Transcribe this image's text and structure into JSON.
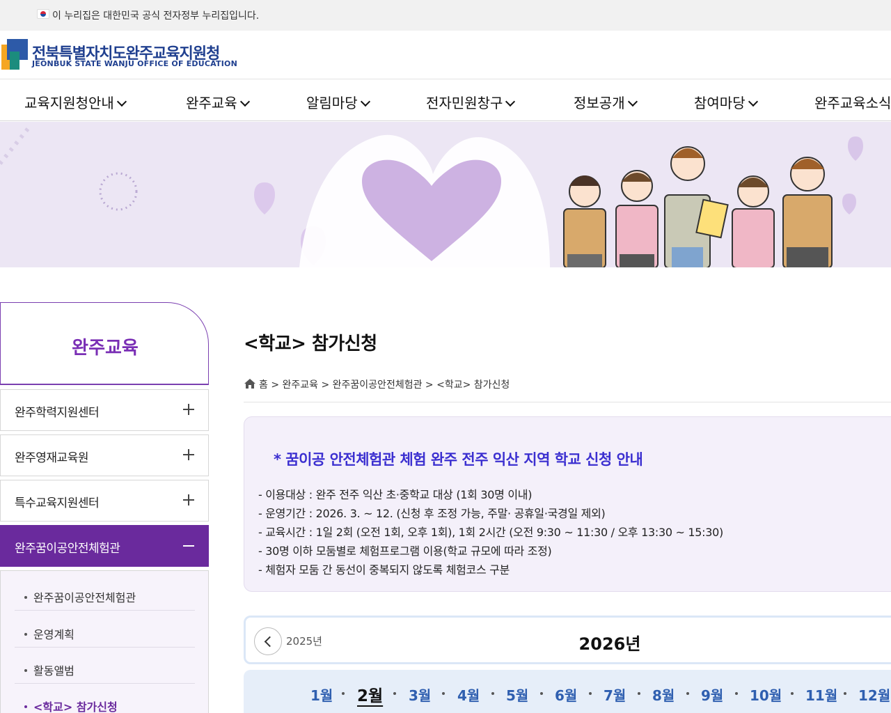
{
  "gov_banner": {
    "text": "이 누리집은 대한민국 공식 전자정부 누리집입니다."
  },
  "header": {
    "title": "전북특별자치도완주교육지원청",
    "subtitle": "JEONBUK STATE WANJU OFFICE OF EDUCATION"
  },
  "nav": [
    "교육지원청안내",
    "완주교육",
    "알림마당",
    "전자민원창구",
    "정보공개",
    "참여마당",
    "완주교육소식"
  ],
  "sidebar": {
    "title": "완주교육",
    "menus": [
      {
        "label": "완주학력지원센터"
      },
      {
        "label": "완주영재교육원"
      },
      {
        "label": "특수교육지원센터"
      },
      {
        "label": "완주꿈이공안전체험관"
      }
    ],
    "submenu": [
      {
        "label": "완주꿈이공안전체험관"
      },
      {
        "label": "운영계획"
      },
      {
        "label": "활동앨범"
      },
      {
        "label": "<학교> 참가신청"
      }
    ]
  },
  "page": {
    "title": "<학교> 참가신청",
    "breadcrumb": "홈 > 완주교육 > 완주꿈이공안전체험관 > <학교> 참가신청"
  },
  "info": {
    "title": "* 꿈이공 안전체험관 체험 완주 전주 익산 지역 학교 신청 안내",
    "lines": [
      "- 이용대상 : 완주 전주 익산 초·중학교 대상 (1회 30명 이내)",
      "- 운영기간 : 2026. 3. ~ 12. (신청 후 조정 가능, 주말· 공휴일·국경일 제외)",
      "- 교육시간 : 1일 2회 (오전 1회, 오후 1회), 1회 2시간 (오전 9:30 ~ 11:30 / 오후 13:30 ~ 15:30)",
      "- 30명 이하 모둠별로 체험프로그램 이용(학교 규모에 따라 조정)",
      "- 체험자 모둠 간 동선이 중복되지 않도록 체험코스 구분"
    ]
  },
  "calendar": {
    "prev_year": "2025년",
    "current_year": "2026년",
    "months": [
      "1월",
      "2월",
      "3월",
      "4월",
      "5월",
      "6월",
      "7월",
      "8월",
      "9월",
      "10월",
      "11월",
      "12월"
    ],
    "selected_month": "2월"
  },
  "colors": {
    "brand_purple": "#6a2a9d",
    "info_title_blue": "#3b2fd0",
    "month_blue": "#2f5fb0",
    "banner_lavender": "#ece6f4"
  }
}
